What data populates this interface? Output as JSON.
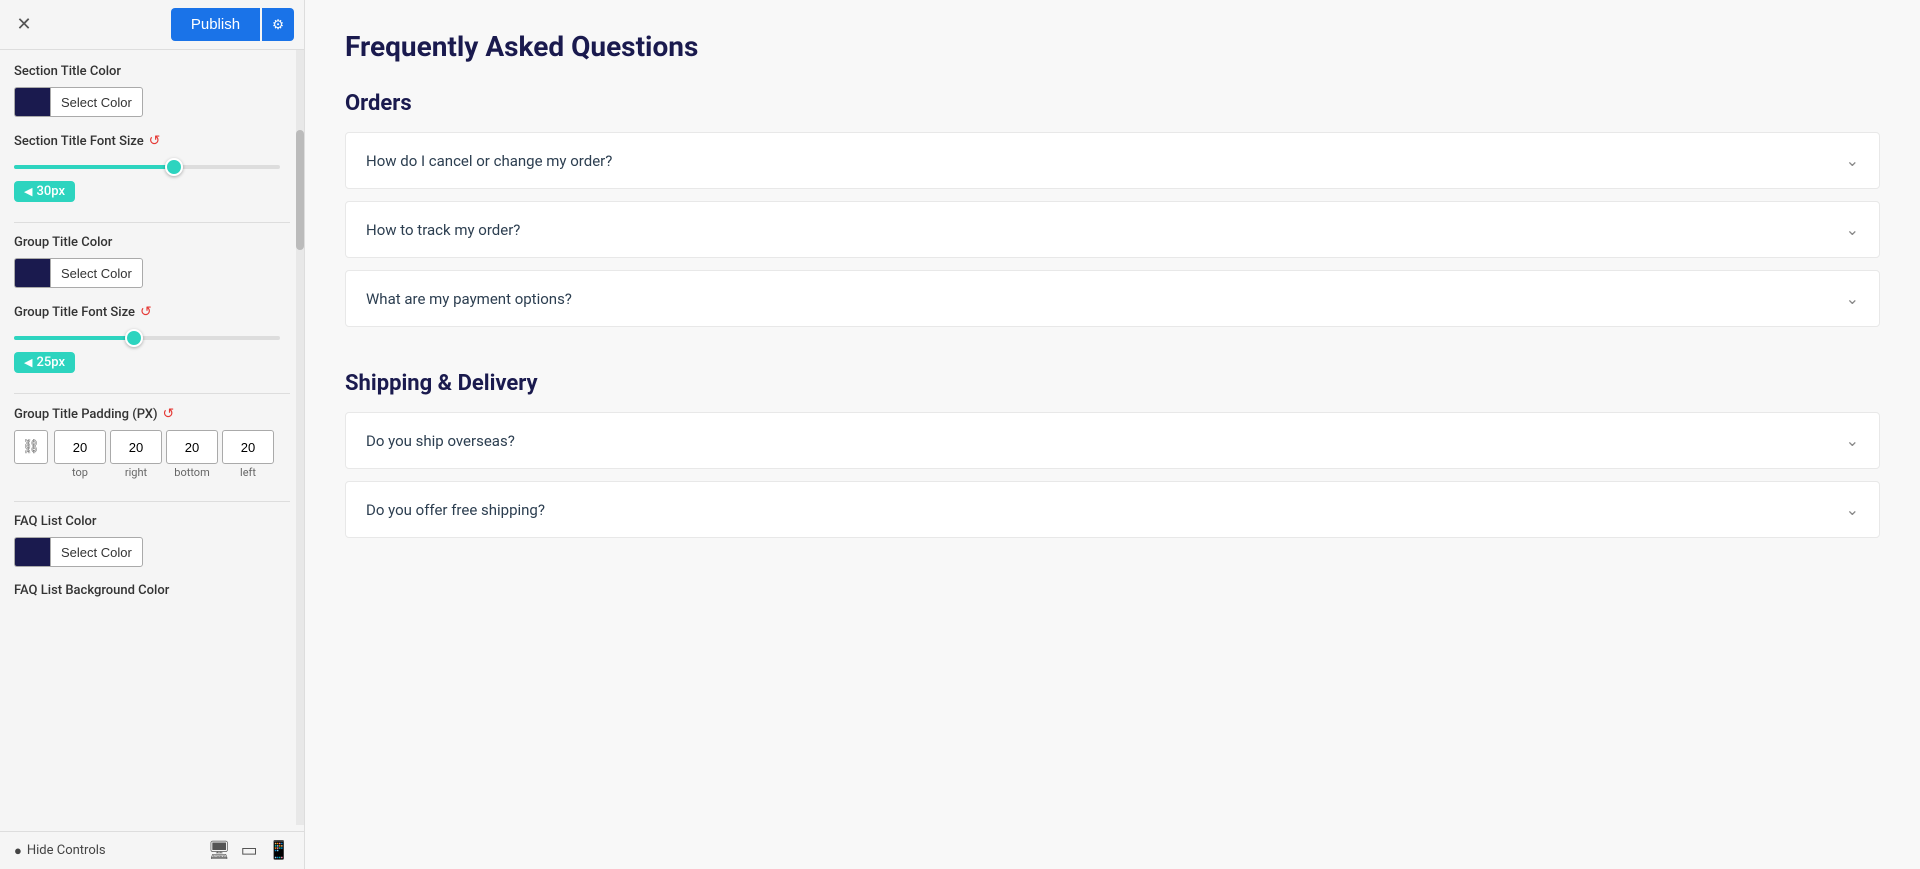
{
  "topbar": {
    "close_label": "✕",
    "publish_label": "Publish",
    "settings_icon": "⚙"
  },
  "controls": {
    "section_title_color": {
      "label": "Section Title Color",
      "color": "#1a1a4e",
      "btn_label": "Select Color"
    },
    "section_title_font_size": {
      "label": "Section Title Font Size",
      "value": "30px",
      "percent": 60
    },
    "group_title_color": {
      "label": "Group Title Color",
      "color": "#1a1a4e",
      "btn_label": "Select Color"
    },
    "group_title_font_size": {
      "label": "Group Title Font Size",
      "value": "25px",
      "percent": 45
    },
    "group_title_padding": {
      "label": "Group Title Padding (PX)",
      "top": "20",
      "right": "20",
      "bottom": "20",
      "left": "20",
      "top_label": "top",
      "right_label": "right",
      "bottom_label": "bottom",
      "left_label": "left"
    },
    "faq_list_color": {
      "label": "FAQ List Color",
      "color": "#1a1a4e",
      "btn_label": "Select Color"
    },
    "faq_list_bg_color": {
      "label": "FAQ List Background Color"
    }
  },
  "bottom": {
    "hide_label": "Hide Controls"
  },
  "faq": {
    "page_title": "Frequently Asked Questions",
    "groups": [
      {
        "title": "Orders",
        "items": [
          {
            "question": "How do I cancel or change my order?"
          },
          {
            "question": "How to track my order?"
          },
          {
            "question": "What are my payment options?"
          }
        ]
      },
      {
        "title": "Shipping & Delivery",
        "items": [
          {
            "question": "Do you ship overseas?"
          },
          {
            "question": "Do you offer free shipping?"
          }
        ]
      }
    ]
  }
}
